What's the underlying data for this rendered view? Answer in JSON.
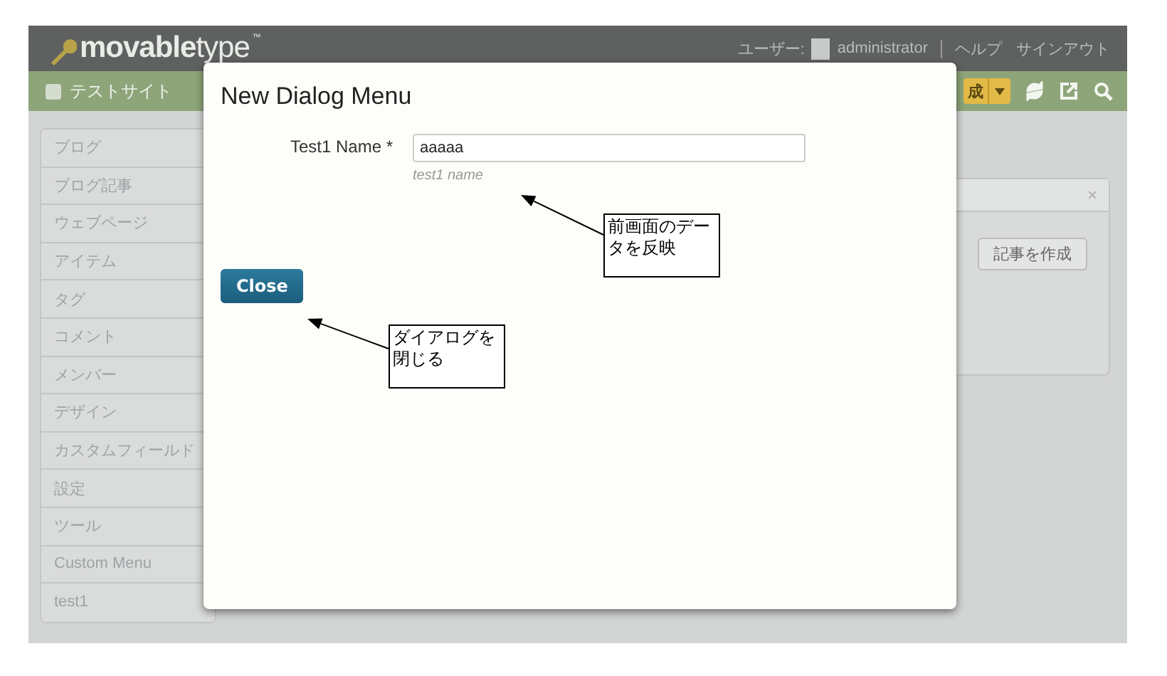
{
  "header": {
    "logo": "**movable**type",
    "logo_mark": "™",
    "user_label": "ユーザー:",
    "username": "administrator",
    "links": [
      "ヘルプ",
      "サインアウト"
    ]
  },
  "site_bar": {
    "site_name": "テストサイト",
    "create_button": "成"
  },
  "sidebar": {
    "items": [
      {
        "label": "ブログ"
      },
      {
        "label": "ブログ記事"
      },
      {
        "label": "ウェブページ"
      },
      {
        "label": "アイテム"
      },
      {
        "label": "タグ"
      },
      {
        "label": "コメント"
      },
      {
        "label": "メンバー"
      },
      {
        "label": "デザイン"
      },
      {
        "label": "カスタムフィールド"
      },
      {
        "label": "設定"
      },
      {
        "label": "ツール"
      },
      {
        "label": "Custom Menu"
      },
      {
        "label": "test1"
      }
    ]
  },
  "widget": {
    "close": "×",
    "button": "記事を作成"
  },
  "dialog": {
    "title": "New Dialog Menu",
    "fields": [
      {
        "label": "Test1 Name *",
        "value": "aaaaa",
        "hint": "test1 name"
      }
    ],
    "buttons": [
      "Close"
    ]
  },
  "annotations": [
    {
      "text": "前画面のデータを反映"
    },
    {
      "text": "ダイアログを閉じる"
    }
  ]
}
